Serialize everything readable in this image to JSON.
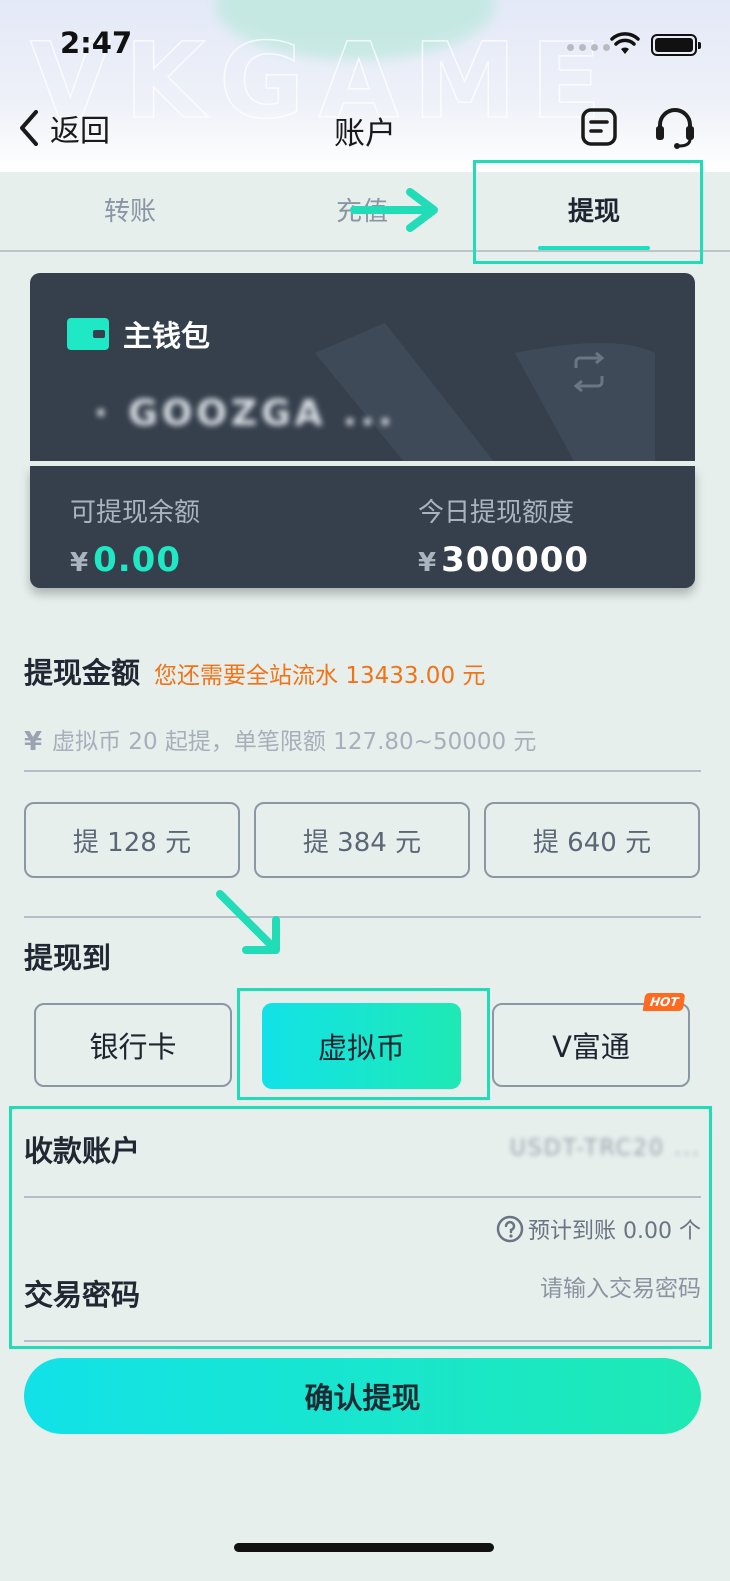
{
  "status_bar": {
    "time": "2:47"
  },
  "nav": {
    "back_label": "返回",
    "title": "账户"
  },
  "tabs": [
    {
      "label": "转账",
      "active": false
    },
    {
      "label": "充值",
      "active": false
    },
    {
      "label": "提现",
      "active": true
    }
  ],
  "wallet": {
    "name": "主钱包",
    "account_masked": "· GOOZGA ...",
    "withdrawable_label": "可提现余额",
    "withdrawable_value": "0.00",
    "daily_limit_label": "今日提现额度",
    "daily_limit_value": "300000",
    "currency_symbol": "¥"
  },
  "amount": {
    "title": "提现金额",
    "warning": "您还需要全站流水 13433.00 元",
    "placeholder": "虚拟币 20 起提，单笔限额 127.80~50000 元",
    "quick_options": [
      "提 128 元",
      "提 384 元",
      "提 640 元"
    ]
  },
  "withdraw_to": {
    "title": "提现到",
    "methods": [
      {
        "label": "银行卡",
        "active": false
      },
      {
        "label": "虚拟币",
        "active": true
      },
      {
        "label": "V富通",
        "active": false,
        "badge": "HOT"
      }
    ]
  },
  "receive_account": {
    "label": "收款账户",
    "value_masked": "USDT-TRC20 ..."
  },
  "estimate": {
    "text": "预计到账 0.00 个"
  },
  "password": {
    "label": "交易密码",
    "placeholder": "请输入交易密码"
  },
  "confirm_label": "确认提现",
  "colors": {
    "accent": "#1ee9b4",
    "accent_cyan": "#12e2e8",
    "card": "#36404d",
    "warning": "#f07318",
    "hot": "#ff6a21"
  }
}
